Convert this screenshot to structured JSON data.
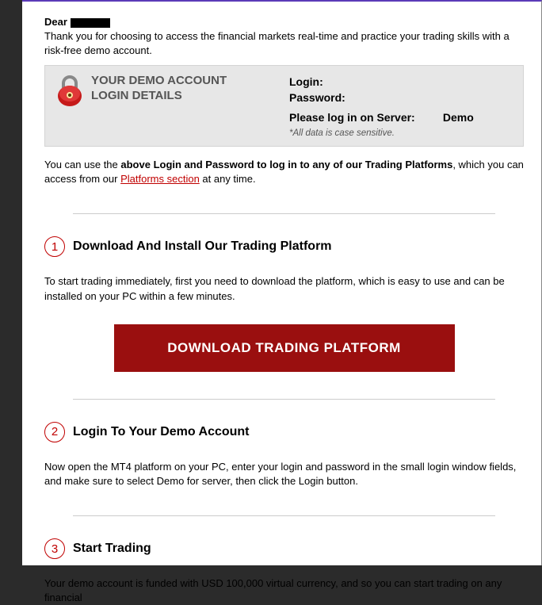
{
  "greeting_prefix": "Dear",
  "intro": "Thank you for choosing to access the financial markets real-time and practice your trading skills with a risk-free demo account.",
  "login_box": {
    "title_line1": "YOUR DEMO ACCOUNT",
    "title_line2": "LOGIN DETAILS",
    "login_label": "Login:",
    "password_label": "Password:",
    "server_label": "Please log in on Server:",
    "server_value": "Demo",
    "note": "*All data is case sensitive."
  },
  "post_box_text_1": "You can use the ",
  "post_box_bold": "above Login and Password to log in to any of our Trading Platforms",
  "post_box_text_2": ", which you can access from our ",
  "post_box_link": "Platforms section",
  "post_box_text_3": " at any time.",
  "steps": [
    {
      "num": "1",
      "title": "Download And Install Our Trading Platform",
      "body": "To start trading immediately, first you need to download the platform, which is easy to use and can be installed on your PC within a few minutes.",
      "button": "DOWNLOAD  TRADING PLATFORM"
    },
    {
      "num": "2",
      "title": "Login To Your Demo Account",
      "body": "Now open the MT4 platform on your PC, enter your login and password in the small login window fields, and make sure to select Demo for server, then click the Login button."
    },
    {
      "num": "3",
      "title": "Start Trading",
      "body": "Your demo account is funded with USD 100,000 virtual currency, and so you can start trading on any financial"
    }
  ]
}
